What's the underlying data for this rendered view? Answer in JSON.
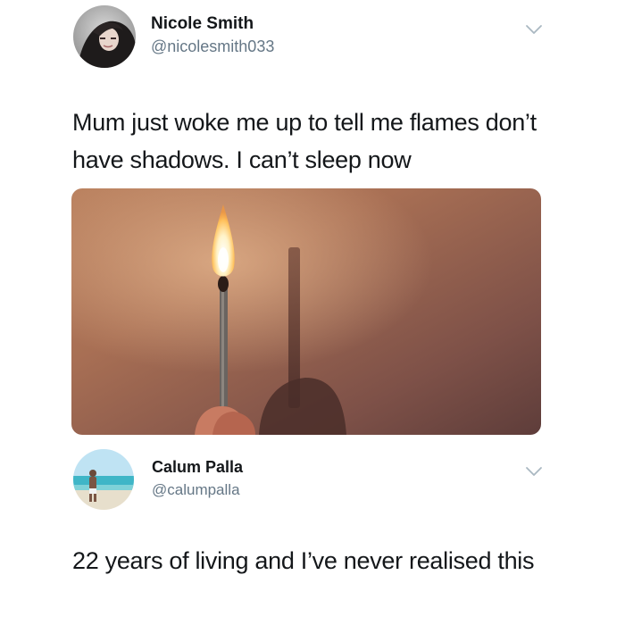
{
  "tweets": [
    {
      "display_name": "Nicole Smith",
      "handle": "@nicolesmith033",
      "text": "Mum just woke me up to tell me flames don’t have shadows. I can’t sleep now",
      "avatar_icon": "profile-photo",
      "menu_icon": "chevron-down-icon",
      "media": {
        "description_icon": "burning-match-photo"
      }
    },
    {
      "display_name": "Calum Palla",
      "handle": "@calumpalla",
      "text": "22 years of living and I’ve never realised this",
      "avatar_icon": "profile-photo",
      "menu_icon": "chevron-down-icon"
    }
  ],
  "colors": {
    "text": "#14171a",
    "secondary_text": "#657786",
    "chevron": "#aab8c2",
    "background": "#ffffff"
  }
}
